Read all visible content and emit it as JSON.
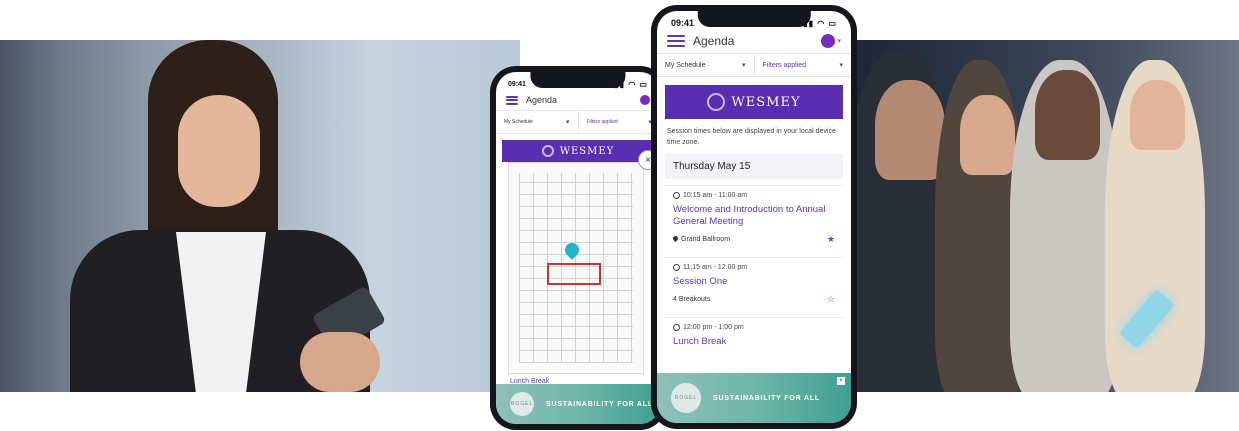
{
  "status_time": "09:41",
  "app": {
    "title": "Agenda",
    "avatar_initial": ""
  },
  "filters": {
    "schedule": "My Schedule",
    "applied": "Filters applied"
  },
  "banner": {
    "brand": "WESMEY"
  },
  "timezone_note": "Session times below are displayed in your local device time zone.",
  "date_heading": "Thursday May 15",
  "sessions": [
    {
      "time": "10:15 am - 11:00 am",
      "title": "Welcome and Introduction to Annual General Meeting",
      "location": "Grand Ballroom",
      "starred": true
    },
    {
      "time": "11:15 am - 12:00 pm",
      "title": "Session One",
      "location": "4 Breakouts",
      "starred": false
    },
    {
      "time": "12:00 pm - 1:00 pm",
      "title": "Lunch Break",
      "location": "",
      "starred": false
    }
  ],
  "ad": {
    "logo_text": "ROGEL",
    "text": "SUSTAINABILITY FOR ALL"
  },
  "back_screen": {
    "behind_text": "Lunch Break"
  },
  "icons": {
    "menu": "hamburger-icon",
    "avatar": "user-avatar",
    "chevron": "chevron-down-icon",
    "clock": "clock-icon",
    "pin": "map-pin-icon",
    "star": "star-icon",
    "close": "close-icon"
  },
  "colors": {
    "accent": "#5b3aa8",
    "banner": "#5a2eb0",
    "ad_bg": "#6fb7a6",
    "pin": "#23b3c6",
    "highlight": "#d03030"
  }
}
